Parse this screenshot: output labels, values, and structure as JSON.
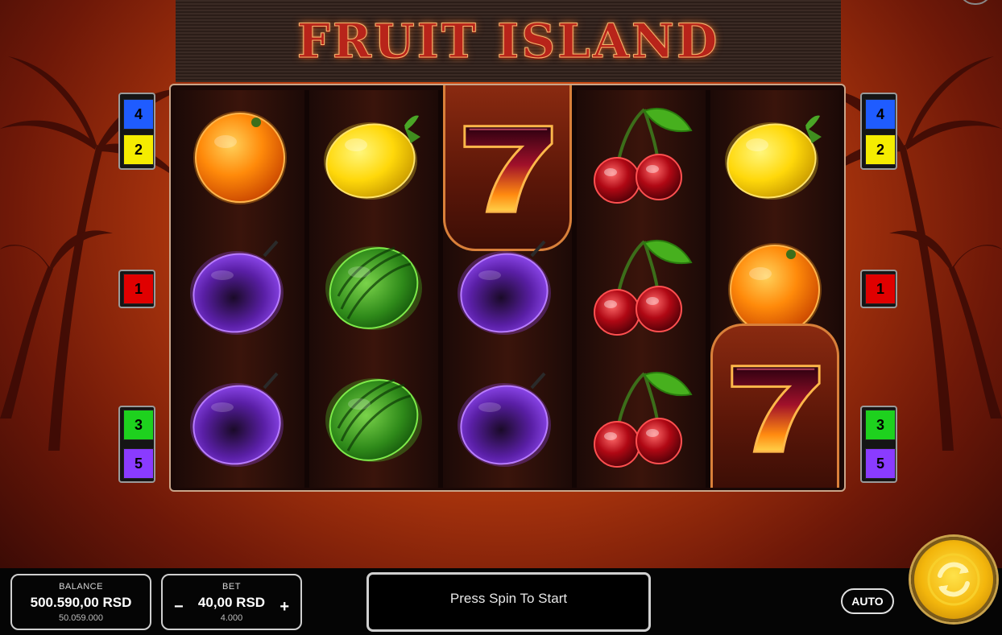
{
  "game": {
    "title": "FRUIT ISLAND"
  },
  "paylines": {
    "left": [
      {
        "number": "4",
        "color": "#1f5cff"
      },
      {
        "number": "2",
        "color": "#f5ec00"
      },
      {
        "number": "1",
        "color": "#e00000"
      },
      {
        "number": "3",
        "color": "#1ed11e"
      },
      {
        "number": "5",
        "color": "#8a3bff"
      }
    ],
    "right": [
      {
        "number": "4",
        "color": "#1f5cff"
      },
      {
        "number": "2",
        "color": "#f5ec00"
      },
      {
        "number": "1",
        "color": "#e00000"
      },
      {
        "number": "3",
        "color": "#1ed11e"
      },
      {
        "number": "5",
        "color": "#8a3bff"
      }
    ]
  },
  "reels": [
    [
      "orange-icon",
      "plum-icon",
      "plum-icon"
    ],
    [
      "lemon-icon",
      "watermelon-icon",
      "watermelon-icon"
    ],
    [
      "seven-icon",
      "plum-icon",
      "plum-icon"
    ],
    [
      "cherry-icon",
      "cherry-icon",
      "cherry-icon"
    ],
    [
      "lemon-icon",
      "orange-icon",
      "seven-icon"
    ]
  ],
  "balance": {
    "label": "BALANCE",
    "value": "500.590,00 RSD",
    "sub": "50.059.000"
  },
  "bet": {
    "label": "BET",
    "value": "40,00 RSD",
    "sub": "4.000",
    "minus": "−",
    "plus": "+"
  },
  "message": "Press Spin To Start",
  "auto_label": "AUTO",
  "colors": {
    "accent": "#f3b60c",
    "frame": "#c9a58a"
  }
}
